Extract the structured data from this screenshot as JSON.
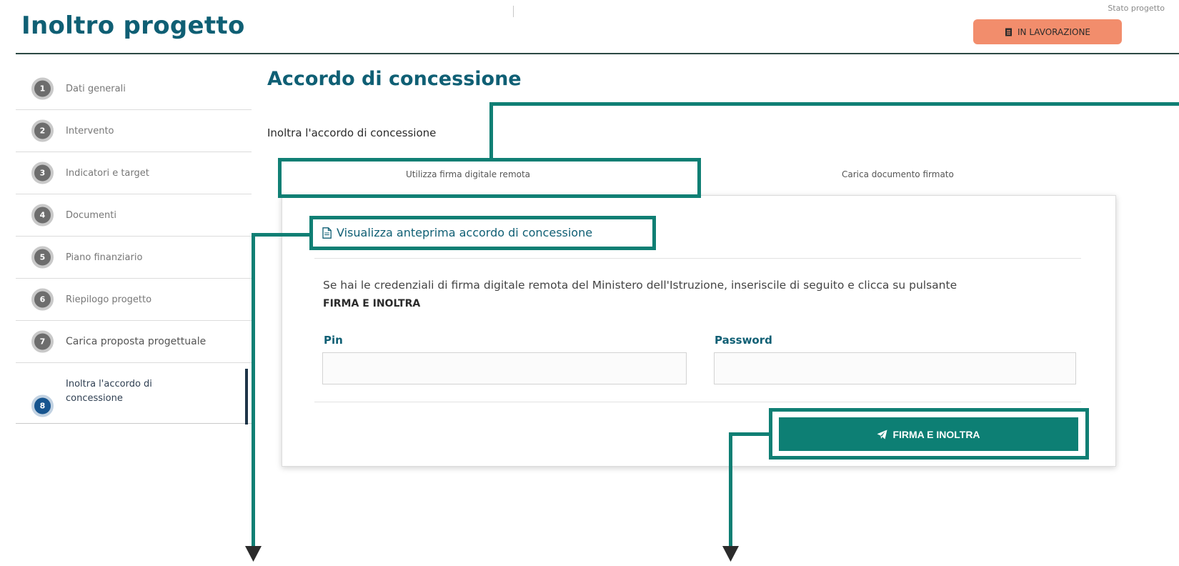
{
  "header": {
    "title": "Inoltro progetto",
    "status_caption": "Stato progetto",
    "status_badge": "IN LAVORAZIONE",
    "status_icon": "document-icon",
    "status_color": "#f28d6c"
  },
  "sidebar": {
    "steps": [
      {
        "number": "1",
        "label": "Dati generali"
      },
      {
        "number": "2",
        "label": "Intervento"
      },
      {
        "number": "3",
        "label": "Indicatori e target"
      },
      {
        "number": "4",
        "label": "Documenti"
      },
      {
        "number": "5",
        "label": "Piano finanziario"
      },
      {
        "number": "6",
        "label": "Riepilogo progetto"
      },
      {
        "number": "7",
        "label": "Carica proposta progettuale"
      },
      {
        "number": "8",
        "label": "Inoltra l'accordo di concessione"
      }
    ]
  },
  "main": {
    "section_title": "Accordo di concessione",
    "sub_title": "Inoltra l'accordo di concessione",
    "tabs": [
      {
        "label": "Utilizza firma digitale remota"
      },
      {
        "label": "Carica documento firmato"
      }
    ],
    "preview_link": "Visualizza anteprima accordo di concessione",
    "instructions": "Se hai le credenziali di firma digitale remota del Ministero dell'Istruzione, inseriscile di seguito e clicca su pulsante",
    "instructions_bold": "FIRMA E INOLTRA",
    "pin_label": "Pin",
    "password_label": "Password",
    "pin_value": "",
    "password_value": "",
    "sign_button": "FIRMA E INOLTRA",
    "accent_color": "#0d7f74",
    "title_color": "#0f5f74"
  }
}
